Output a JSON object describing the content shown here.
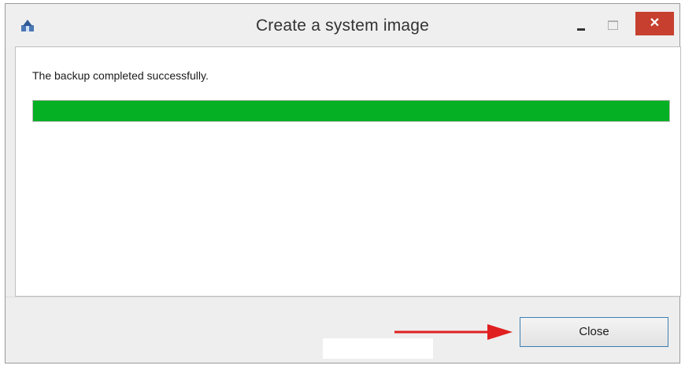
{
  "window": {
    "title": "Create a system image"
  },
  "titlebar": {
    "minimize_glyph": "",
    "maximize_glyph": "",
    "close_glyph": "✕"
  },
  "main": {
    "status_message": "The backup completed successfully.",
    "progress_percent": 100
  },
  "footer": {
    "close_label": "Close"
  },
  "icons": {
    "app": "backup-app-icon",
    "arrow": "red-arrow-annotation"
  },
  "colors": {
    "progress": "#06b025",
    "close_hover": "#c7402f",
    "arrow": "#e02020"
  }
}
